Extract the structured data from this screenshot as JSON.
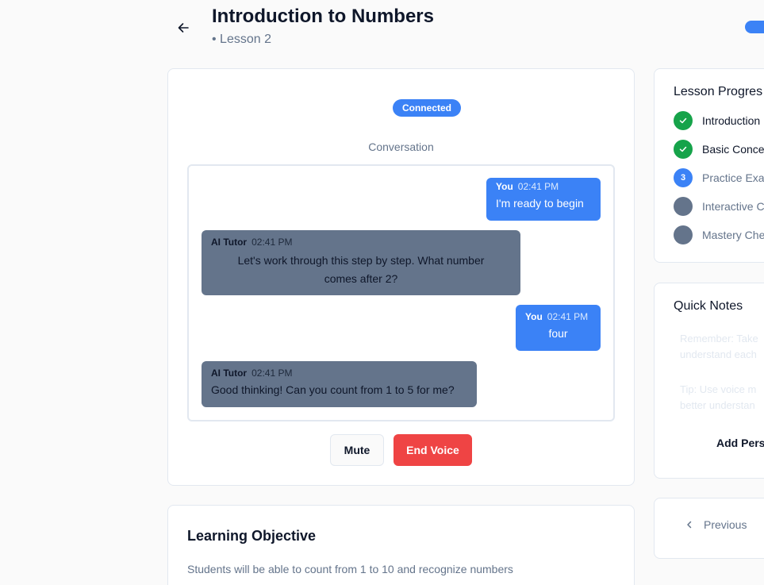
{
  "header": {
    "title": "Introduction to Numbers",
    "subtitle": "• Lesson 2"
  },
  "voice": {
    "status": "Connected",
    "conversation_label": "Conversation",
    "messages": [
      {
        "role": "user",
        "who": "You",
        "time": "02:41 PM",
        "text": "I'm ready to begin"
      },
      {
        "role": "ai",
        "who": "AI Tutor",
        "time": "02:41 PM",
        "text_line1": "Let's work through this step by step. What number",
        "text_line2": "comes after 2?"
      },
      {
        "role": "user",
        "who": "You",
        "time": "02:41 PM",
        "text": "four"
      },
      {
        "role": "ai",
        "who": "AI Tutor",
        "time": "02:41 PM",
        "text": "Good thinking! Can you count from 1 to 5 for me?"
      }
    ],
    "mute_label": "Mute",
    "end_label": "End Voice"
  },
  "objective": {
    "title": "Learning Objective",
    "text": "Students will be able to count from 1 to 10 and recognize numbers"
  },
  "progress": {
    "title": "Lesson Progres",
    "steps": [
      {
        "label": "Introduction",
        "status": "complete"
      },
      {
        "label": "Basic Conce",
        "status": "complete"
      },
      {
        "label": "Practice Exa",
        "status": "current",
        "number": "3"
      },
      {
        "label": "Interactive C",
        "status": "upcoming"
      },
      {
        "label": "Mastery Che",
        "status": "upcoming"
      }
    ]
  },
  "notes": {
    "title": "Quick Notes",
    "note1_line1": "Remember: Take",
    "note1_line2": "understand each",
    "note2_line1": "Tip: Use voice m",
    "note2_line2": "better understan",
    "add_label": "Add Pers"
  },
  "nav": {
    "previous_label": "Previous"
  },
  "colors": {
    "primary": "#3b82f6",
    "danger": "#ef4444",
    "success": "#16a34a",
    "muted": "#64748b",
    "border": "#e2e8f0"
  }
}
